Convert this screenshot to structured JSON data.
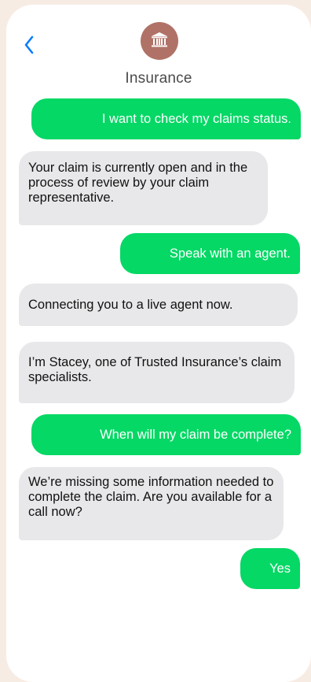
{
  "header": {
    "contact_name": "Insurance",
    "avatar_icon": "bank-building-icon",
    "avatar_color": "#b07267",
    "back_icon": "chevron-left-icon",
    "accent_color": "#0a7cff"
  },
  "messages": [
    {
      "direction": "sent",
      "text": "I want to check my claims status."
    },
    {
      "direction": "received",
      "text": "Your claim is currently open and in the process of review by your claim representative."
    },
    {
      "direction": "sent",
      "text": "Speak with an agent."
    },
    {
      "direction": "received",
      "text": "Connecting you to a live agent now."
    },
    {
      "direction": "received",
      "text": "I’m Stacey, one of Trusted Insurance’s claim specialists."
    },
    {
      "direction": "sent",
      "text": "When will my claim be complete?"
    },
    {
      "direction": "received",
      "text": "We’re missing some information needed to complete the claim. Are you available for a call now?"
    },
    {
      "direction": "sent",
      "text": "Yes"
    }
  ],
  "colors": {
    "sent_bubble": "#05d865",
    "received_bubble": "#e8e8ea",
    "background": "#f7ece4"
  }
}
